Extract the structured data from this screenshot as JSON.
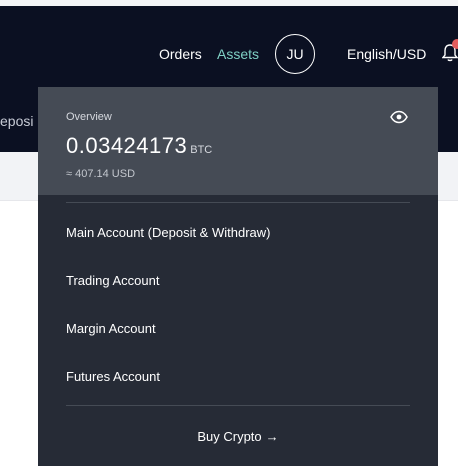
{
  "header": {
    "orders_label": "Orders",
    "assets_label": "Assets",
    "avatar_initials": "JU",
    "language_currency": "English/USD",
    "subnav_text": "eposi"
  },
  "assets_dropdown": {
    "overview_label": "Overview",
    "balance_amount": "0.03424173",
    "balance_unit": "BTC",
    "balance_usd": "≈ 407.14 USD",
    "menu_items": [
      {
        "label": "Main Account (Deposit & Withdraw)"
      },
      {
        "label": "Trading Account"
      },
      {
        "label": "Margin Account"
      },
      {
        "label": "Futures Account"
      }
    ],
    "buy_crypto_label": "Buy Crypto",
    "buy_crypto_arrow": "→"
  },
  "icons": {
    "eye": "eye-icon",
    "bell": "bell-icon"
  },
  "colors": {
    "nav_background": "#0b1022",
    "assets_accent": "#7fd0c4",
    "dropdown_background": "#262b36",
    "overview_background": "#454b55",
    "notification_dot": "#e35d5d"
  }
}
